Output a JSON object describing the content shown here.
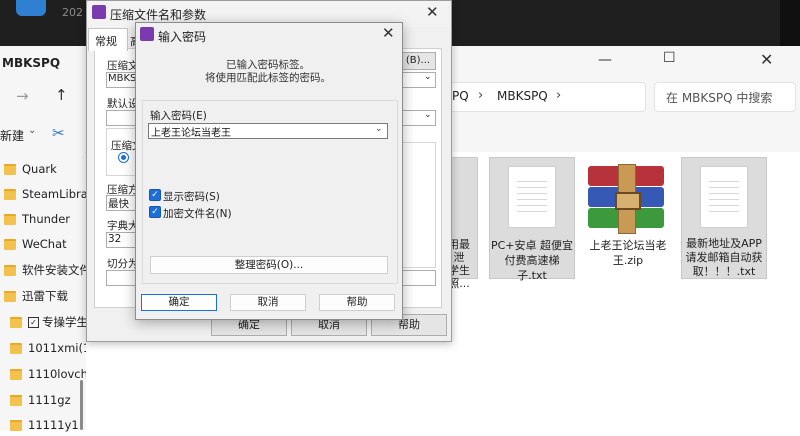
{
  "background_window": {
    "year_text": "202"
  },
  "explorer": {
    "title": "MBKSPQ",
    "address": {
      "segments": [
        "PQ",
        "MBKSPQ"
      ]
    },
    "search_placeholder": "在 MBKSPQ 中搜索",
    "toolbar": {
      "new_label": "新建"
    },
    "sidebar": {
      "items": [
        {
          "label": "Quark"
        },
        {
          "label": "SteamLibrary"
        },
        {
          "label": "Thunder"
        },
        {
          "label": "WeChat"
        },
        {
          "label": "软件安装文件"
        },
        {
          "label": "迅雷下载"
        },
        {
          "label": "专操学生"
        },
        {
          "label": "1011xmi(1"
        },
        {
          "label": "1110lovch"
        },
        {
          "label": "1111gz"
        },
        {
          "label": "11111y1"
        }
      ]
    },
    "files": [
      {
        "label_lines": [
          "用最",
          "泄",
          "学生",
          "照..."
        ],
        "icon": "document-icon"
      },
      {
        "label_lines": [
          "PC+安卓 超便宜",
          "付费高速梯子.txt"
        ],
        "icon": "document-icon"
      },
      {
        "label_lines": [
          "上老王论坛当老",
          "王.zip"
        ],
        "icon": "winrar-archive-icon"
      },
      {
        "label_lines": [
          "最新地址及APP",
          "请发邮箱自动获",
          "取！！！.txt"
        ],
        "icon": "document-icon"
      }
    ]
  },
  "archive_dialog": {
    "title": "压缩文件名和参数",
    "tabs": [
      "常规",
      "高"
    ],
    "labels": {
      "archive_name": "压缩文",
      "archive_value": "MBKSP",
      "default_settings": "默认设置",
      "format": "压缩文",
      "method": "压缩方",
      "method_value": "最快",
      "dict": "字典大",
      "dict_value": "32",
      "split": "切分为分",
      "browse": "(B)..."
    },
    "buttons": {
      "ok": "确定",
      "cancel": "取消",
      "help": "帮助"
    }
  },
  "password_dialog": {
    "title": "输入密码",
    "message_line1": "已输入密码标签。",
    "message_line2": "将使用匹配此标签的密码。",
    "password_label": "输入密码(E)",
    "password_value": "上老王论坛当老王",
    "show_password": {
      "label": "显示密码(S)",
      "checked": true
    },
    "encrypt_names": {
      "label": "加密文件名(N)",
      "checked": true
    },
    "manage_button": "整理密码(O)...",
    "buttons": {
      "ok": "确定",
      "cancel": "取消",
      "help": "帮助"
    },
    "accent": "#1c6fd6"
  }
}
